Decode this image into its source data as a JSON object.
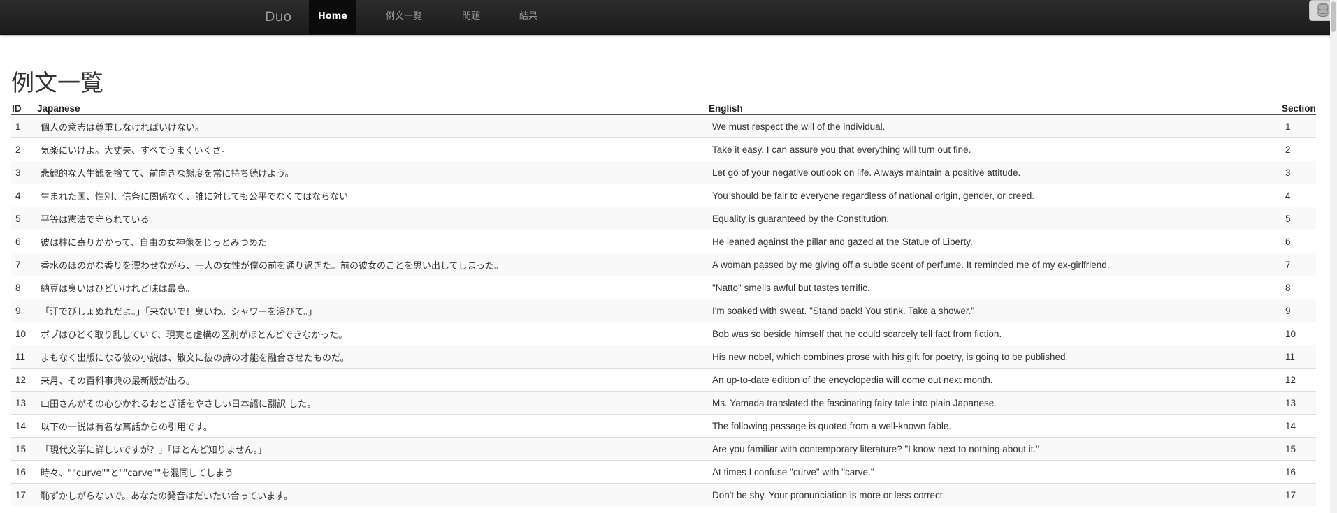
{
  "navbar": {
    "brand": "Duo",
    "items": [
      {
        "label": "Home",
        "active": true
      },
      {
        "label": "例文一覧",
        "active": false
      },
      {
        "label": "問題",
        "active": false
      },
      {
        "label": "結果",
        "active": false
      }
    ],
    "corner_icon": "database-icon"
  },
  "page": {
    "title": "例文一覧"
  },
  "table": {
    "columns": [
      "ID",
      "Japanese",
      "English",
      "Section"
    ],
    "rows": [
      {
        "id": "1",
        "japanese": "個人の意志は尊重しなければいけない。",
        "english": "We must respect the will of the individual.",
        "section": "1"
      },
      {
        "id": "2",
        "japanese": "気楽にいけよ。大丈夫、すべてうまくいくさ。",
        "english": "Take it easy. I can assure you that everything will turn out fine.",
        "section": "2"
      },
      {
        "id": "3",
        "japanese": "悲観的な人生観を捨てて、前向きな態度を常に持ち続けよう。",
        "english": "Let go of your negative outlook on life. Always maintain a positive attitude.",
        "section": "3"
      },
      {
        "id": "4",
        "japanese": "生まれた国、性別、信条に関係なく、誰に対しても公平でなくてはならない",
        "english": "You should be fair to everyone regardless of national origin, gender, or creed.",
        "section": "4"
      },
      {
        "id": "5",
        "japanese": "平等は憲法で守られている。",
        "english": "Equality is guaranteed by the Constitution.",
        "section": "5"
      },
      {
        "id": "6",
        "japanese": "彼は柱に寄りかかって、自由の女神像をじっとみつめた",
        "english": "He leaned against the pillar and gazed at the Statue of Liberty.",
        "section": "6"
      },
      {
        "id": "7",
        "japanese": "香水のほのかな香りを漂わせながら、一人の女性が僕の前を通り過ぎた。前の彼女のことを思い出してしまった。",
        "english": "A woman passed by me giving off a subtle scent of perfume. It reminded me of my ex-girlfriend.",
        "section": "7"
      },
      {
        "id": "8",
        "japanese": "納豆は臭いはひどいけれど味は最高。",
        "english": "\"Natto\" smells awful but tastes terrific.",
        "section": "8"
      },
      {
        "id": "9",
        "japanese": "「汗でびしょぬれだよ。」「来ないで！臭いわ。シャワーを浴びて。」",
        "english": "I'm soaked with sweat. \"Stand back! You stink. Take a shower.\"",
        "section": "9"
      },
      {
        "id": "10",
        "japanese": "ボブはひどく取り乱していて、現実と虚構の区別がほとんどできなかった。",
        "english": "Bob was so beside himself that he could scarcely tell fact from fiction.",
        "section": "10"
      },
      {
        "id": "11",
        "japanese": "まもなく出版になる彼の小説は、散文に彼の詩の才能を融合させたものだ。",
        "english": "His new nobel, which combines prose with his gift for poetry, is going to be published.",
        "section": "11"
      },
      {
        "id": "12",
        "japanese": "来月、その百科事典の最新版が出る。",
        "english": "An up-to-date edition of the encyclopedia will come out next month.",
        "section": "12"
      },
      {
        "id": "13",
        "japanese": "山田さんがその心ひかれるおとぎ話をやさしい日本語に翻訳 した。",
        "english": "Ms. Yamada translated the fascinating fairy tale into plain Japanese.",
        "section": "13"
      },
      {
        "id": "14",
        "japanese": "以下の一説は有名な寓話からの引用です。",
        "english": "The following passage is quoted from a well-known fable.",
        "section": "14"
      },
      {
        "id": "15",
        "japanese": "「現代文学に詳しいですが？」「ほとんど知りません。」",
        "english": "Are you familiar with contemporary literature? \"I know next to nothing about it.\"",
        "section": "15"
      },
      {
        "id": "16",
        "japanese": "時々、\"\"curve\"\"と\"\"carve\"\"を混同してしまう",
        "english": "At times I confuse \"curve\" with \"carve.\"",
        "section": "16"
      },
      {
        "id": "17",
        "japanese": "恥ずかしがらないで。あなたの発音はだいたい合っています。",
        "english": "Don't be shy. Your pronunciation is more or less correct.",
        "section": "17"
      }
    ]
  }
}
